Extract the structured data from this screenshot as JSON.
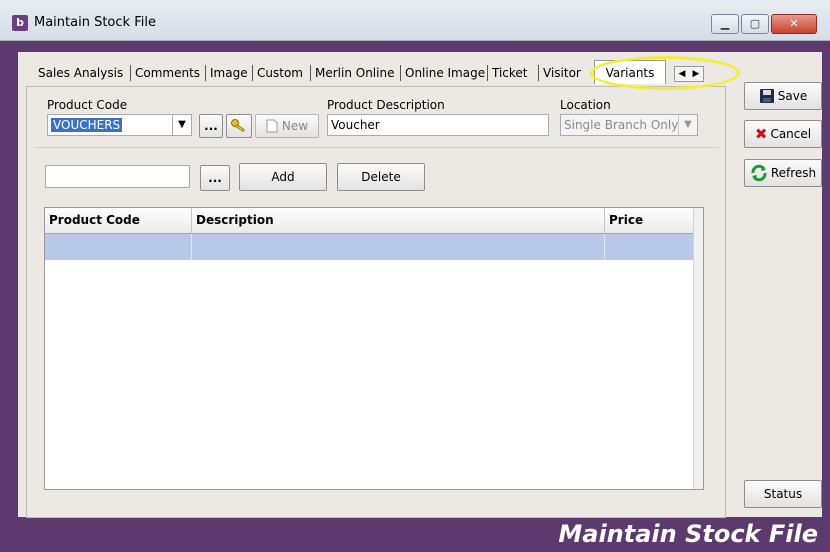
{
  "window": {
    "title": "Maintain Stock File",
    "app_icon_letter": "b",
    "footer_title": "Maintain Stock File",
    "controls": {
      "minimize": "▁",
      "maximize": "▢",
      "close": "✕"
    }
  },
  "tabs": [
    {
      "label": "Sales Analysis"
    },
    {
      "label": "Comments"
    },
    {
      "label": "Image"
    },
    {
      "label": "Custom"
    },
    {
      "label": "Merlin Online"
    },
    {
      "label": "Online Image"
    },
    {
      "label": "Ticket"
    },
    {
      "label": "Visitor"
    },
    {
      "label": "Variants",
      "active": true
    }
  ],
  "tab_scroll": {
    "left": "◀",
    "right": "▶"
  },
  "form": {
    "product_code_label": "Product Code",
    "product_code_value": "VOUCHERS",
    "browse_label": "...",
    "new_label": "New",
    "product_description_label": "Product Description",
    "product_description_value": "Voucher",
    "location_label": "Location",
    "location_value": "Single Branch Only"
  },
  "variant_entry": {
    "input_value": "",
    "browse_label": "...",
    "add_label": "Add",
    "delete_label": "Delete"
  },
  "grid": {
    "columns": [
      "Product Code",
      "Description",
      "Price"
    ],
    "rows": [
      {
        "product_code": "",
        "description": "",
        "price": ""
      }
    ]
  },
  "side_buttons": {
    "save": "Save",
    "cancel": "Cancel",
    "refresh": "Refresh",
    "status": "Status"
  },
  "colors": {
    "window_frame": "#5c3a6e",
    "selected_row": "#b7c9e6",
    "highlight_ring": "#f2ee38"
  }
}
